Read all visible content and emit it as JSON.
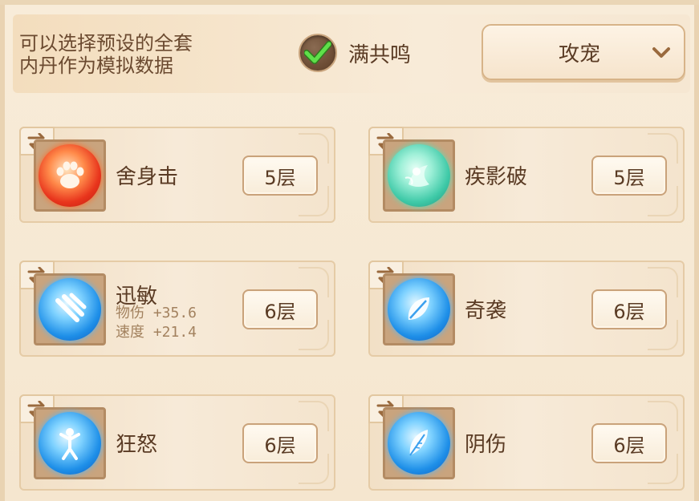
{
  "header": {
    "description_line1": "可以选择预设的全套",
    "description_line2": "内丹作为模拟数据",
    "resonance_label": "满共鸣",
    "resonance_checked": true,
    "preset_dropdown_value": "攻宠"
  },
  "cards": [
    {
      "name": "舍身击",
      "level": "5层",
      "orb": "red",
      "icon": "paw-icon"
    },
    {
      "name": "疾影破",
      "level": "5层",
      "orb": "green",
      "icon": "spirit-icon"
    },
    {
      "name": "迅敏",
      "level": "6层",
      "orb": "blue",
      "icon": "claw-icon",
      "stats": [
        "物伤 +35.6",
        "速度 +21.4"
      ]
    },
    {
      "name": "奇袭",
      "level": "6层",
      "orb": "blue",
      "icon": "leaf-icon"
    },
    {
      "name": "狂怒",
      "level": "6层",
      "orb": "blue",
      "icon": "figure-icon"
    },
    {
      "name": "阴伤",
      "level": "6层",
      "orb": "blue",
      "icon": "feather-icon"
    }
  ],
  "colors": {
    "background": "#f6e9d4",
    "text": "#5a3b24",
    "stat_text": "#a3825f",
    "check": "#4ccf3e",
    "swap_arrow": "#9a6a3e"
  }
}
